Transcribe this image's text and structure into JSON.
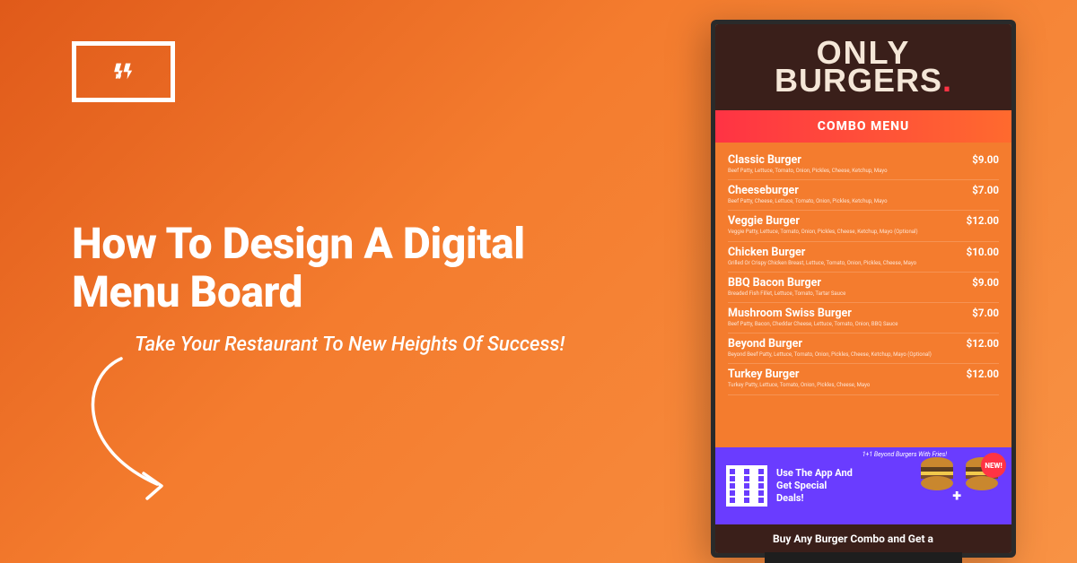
{
  "hero": {
    "headline": "How To Design A Digital Menu Board",
    "subheadline": "Take Your Restaurant To New Heights Of Success!"
  },
  "menu": {
    "brand_line1": "ONLY",
    "brand_line2": "BURGERS",
    "combo_label": "COMBO MENU",
    "items": [
      {
        "name": "Classic Burger",
        "price": "$9.00",
        "desc": "Beef Patty, Lettuce, Tomato, Onion, Pickles, Cheese, Ketchup, Mayo"
      },
      {
        "name": "Cheeseburger",
        "price": "$7.00",
        "desc": "Beef Patty, Cheese, Lettuce, Tomato, Onion, Pickles, Ketchup, Mayo"
      },
      {
        "name": "Veggie Burger",
        "price": "$12.00",
        "desc": "Veggie Patty, Lettuce, Tomato, Onion, Pickles, Cheese, Ketchup, Mayo (Optional)"
      },
      {
        "name": "Chicken Burger",
        "price": "$10.00",
        "desc": "Grilled Or Crispy Chicken Breast, Lettuce, Tomato, Onion, Pickles, Cheese, Mayo"
      },
      {
        "name": "BBQ Bacon Burger",
        "price": "$9.00",
        "desc": "Breaded Fish Fillet, Lettuce, Tomato, Tartar Sauce"
      },
      {
        "name": "Mushroom Swiss Burger",
        "price": "$7.00",
        "desc": "Beef Patty, Bacon, Cheddar Cheese, Lettuce, Tomato, Onion, BBQ Sauce"
      },
      {
        "name": "Beyond Burger",
        "price": "$12.00",
        "desc": "Beyond Beef Patty, Lettuce, Tomato, Onion, Pickles, Cheese, Ketchup, Mayo (Optional)"
      },
      {
        "name": "Turkey Burger",
        "price": "$12.00",
        "desc": "Turkey Patty, Lettuce, Tomato, Onion, Pickles, Cheese, Mayo"
      }
    ],
    "promo_text": "Use The App And Get Special Deals!",
    "promo_caption": "1+1 Beyond Burgers With Fries!",
    "new_badge": "NEW!",
    "ticker": "Buy Any Burger Combo and Get a"
  }
}
